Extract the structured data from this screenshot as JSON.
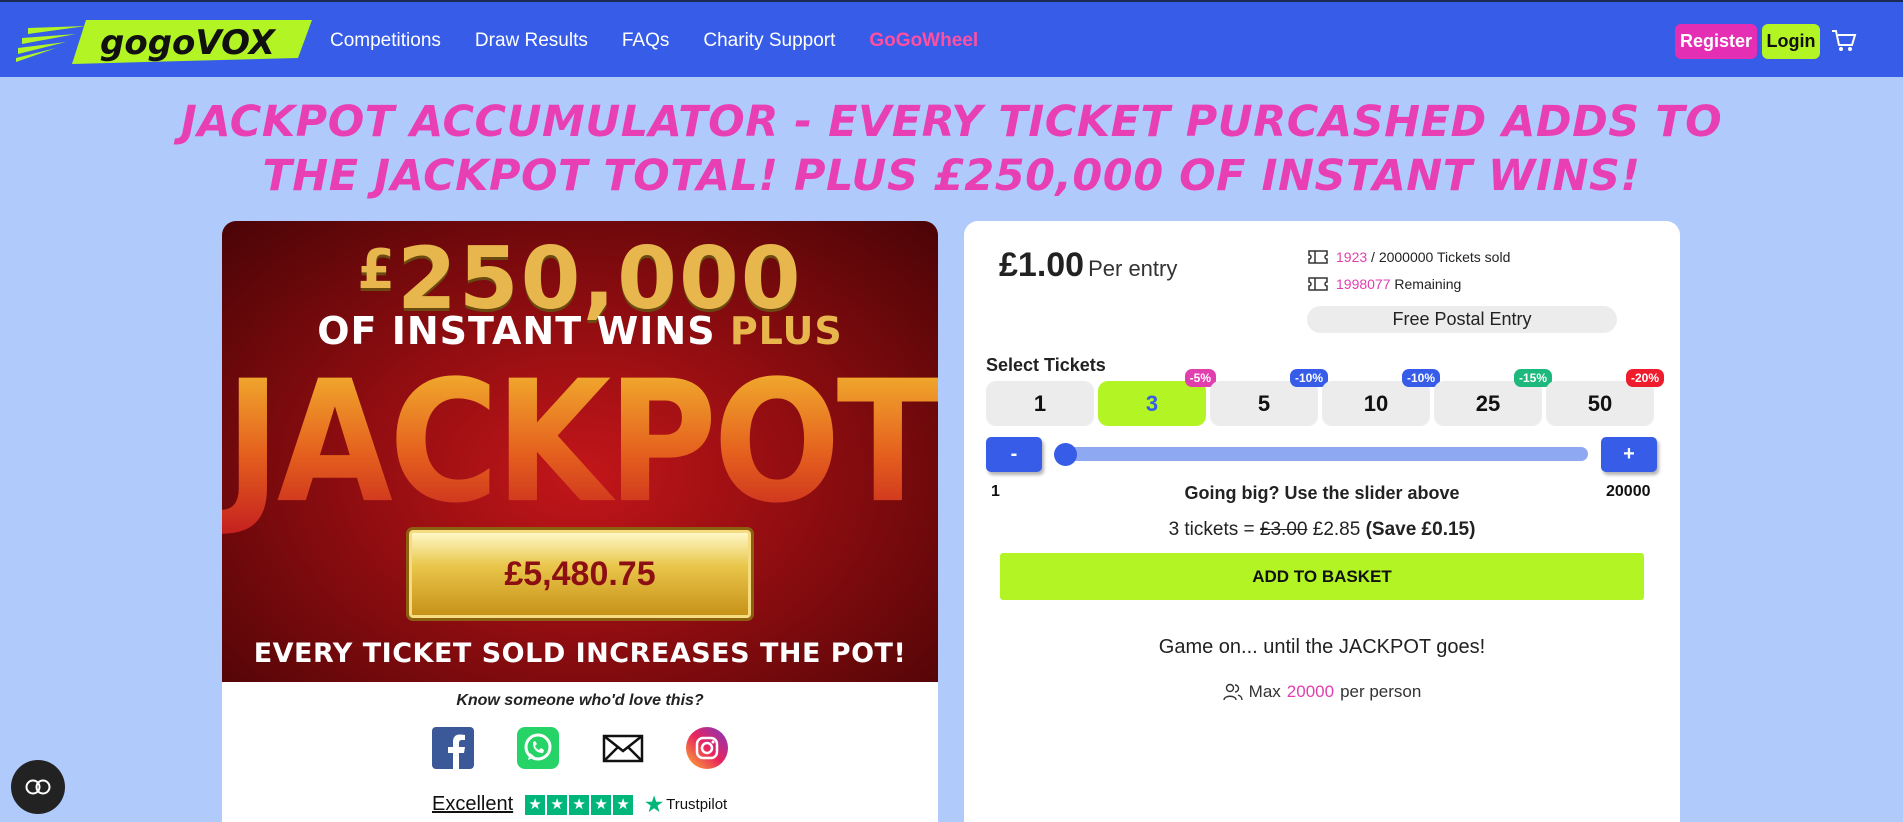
{
  "nav": {
    "logo_text": "gogoVOX",
    "links": [
      "Competitions",
      "Draw Results",
      "FAQs",
      "Charity Support",
      "GoGoWheel"
    ],
    "register": "Register",
    "login": "Login"
  },
  "headline": {
    "line1": "JACKPOT ACCUMULATOR - EVERY TICKET PURCASHED ADDS TO",
    "line2": "THE JACKPOT TOTAL! PLUS £250,000 OF INSTANT WINS!"
  },
  "promo": {
    "pound": "£",
    "amount": "250,000",
    "instant": "OF INSTANT WINS",
    "plus": "PLUS",
    "jackpot": "JACKPOT",
    "pot_value": "£5,480.75",
    "every": "EVERY TICKET SOLD INCREASES THE POT!"
  },
  "share": {
    "prompt": "Know someone who'd love this?"
  },
  "trust": {
    "rating": "Excellent",
    "brand": "Trustpilot"
  },
  "pricing": {
    "price": "£1.00",
    "per": "Per entry",
    "sold": "1923",
    "total": "/ 2000000 Tickets sold",
    "remaining_num": "1998077",
    "remaining_label": "Remaining",
    "postal": "Free Postal Entry"
  },
  "select": {
    "label": "Select Tickets",
    "options": [
      {
        "qty": "1",
        "badge": ""
      },
      {
        "qty": "3",
        "badge": "-5%"
      },
      {
        "qty": "5",
        "badge": "-10%"
      },
      {
        "qty": "10",
        "badge": "-10%"
      },
      {
        "qty": "25",
        "badge": "-15%"
      },
      {
        "qty": "50",
        "badge": "-20%"
      }
    ],
    "minus": "-",
    "plus": "+",
    "min": "1",
    "max": "20000",
    "hint": "Going big? Use the slider above"
  },
  "summary": {
    "prefix": "3 tickets =",
    "old": "£3.00",
    "new": "£2.85",
    "save": "(Save £0.15)"
  },
  "add_to_basket": "ADD TO BASKET",
  "gameon": "Game on... until the JACKPOT goes!",
  "maxper": {
    "prefix": "Max",
    "num": "20000",
    "suffix": "per person"
  },
  "colors": {
    "nav": "#365ce8",
    "lime": "#b2f424",
    "pink": "#e83fb5",
    "bg": "#b0cbfb"
  }
}
